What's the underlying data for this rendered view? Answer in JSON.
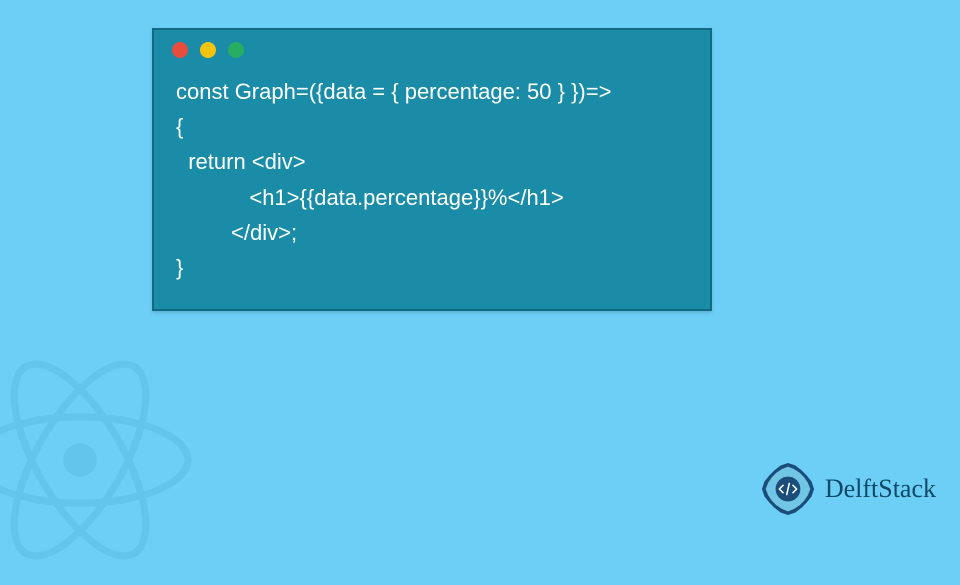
{
  "code": {
    "lines": [
      "const Graph=({data = { percentage: 50 } })=>",
      "{",
      "  return <div>",
      "            <h1>{{data.percentage}}%</h1>",
      "         </div>;",
      "}"
    ]
  },
  "logo": {
    "text": "DelftStack"
  },
  "window_controls": {
    "red": "#e74c3c",
    "yellow": "#f1c40f",
    "green": "#27ae60"
  }
}
